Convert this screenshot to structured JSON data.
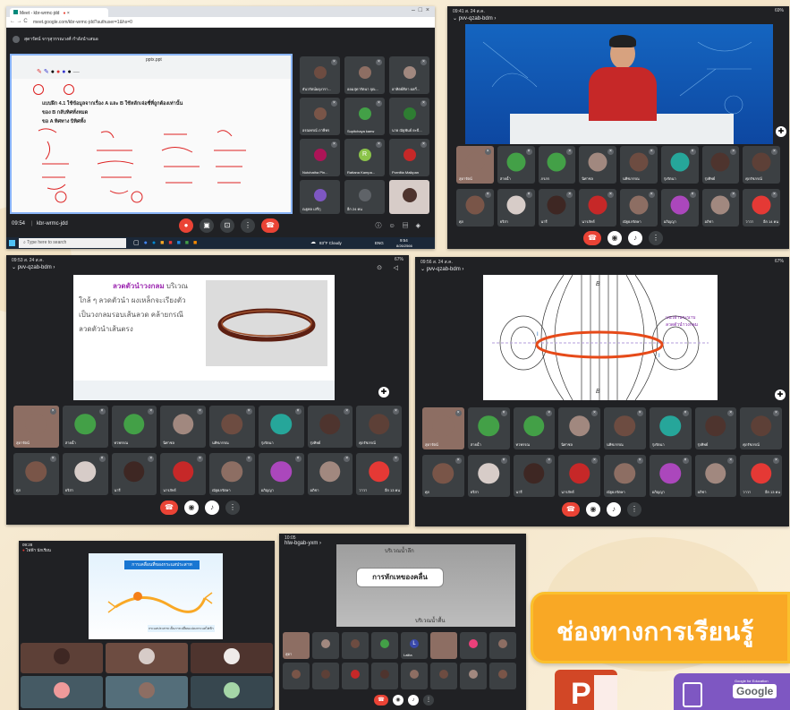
{
  "s1": {
    "tab_title": "Meet - kbr-wrmc-jdd",
    "url": "meet.google.com/kbr-wrmc-jdd?authuser=1&hs=0",
    "presenter": "สุดารัตน์ จารุสุวรรณวงศ์ กำลังนำเสนอ",
    "annotate_label": "pptx.ppt",
    "time": "09:54",
    "meeting_code": "kbr-wrmc-jdd",
    "taskbar_search": "Type here to search",
    "weather": "83°F Cloudy",
    "clock_time": "9:54",
    "clock_date": "8/26/2566",
    "lang": "ENG",
    "participants": [
      "ธันวรัตน์ผดุงวรา...",
      "ออมสุดารัตนา จุณ...",
      "อาทิตย์ศิลา ผลกี่...",
      "อรณทรณ์ ภาษีพร",
      "Supitchaya kaew",
      "นาย ณัฐพันธ์ ยะบี...",
      "Nutchatha Pin...",
      "Rattana Kampa...",
      "Pornfita Maikpan",
      "ณฐพล เสรีกุ",
      "อีก 24 คน",
      ""
    ],
    "lines": [
      "แบบฝึก 4.1 ใช้ข้อมูลจากเรื่อง A และ B ใช้หลักเจ่อซี่ที่ถูกต้องเท่านั้น",
      "ของ B กลับทิศทั่งหมด",
      "ขอ A ทิศทาง บิทิศทั้ง"
    ]
  },
  "s2": {
    "status_time": "09:41",
    "status_date": "ส. 24 ส.ค.",
    "battery": "69%",
    "meeting": "pvv-qzab-bdm",
    "names": [
      "สุดารัตน์",
      "สายน้ำ",
      "ภรภร",
      "นิศาชล",
      "นพิชภรรณ",
      "รุ่งรัตนา",
      "รุ่งทิพย์",
      "ศุภรัชภรณ์",
      "ศุภ",
      "ธริสา",
      "นารี",
      "นารภัทร์",
      "ณัฐธภรัตษา",
      "อภิญญา",
      "อภิชา",
      "วาวา"
    ],
    "more": "อีก 14 คน"
  },
  "s3": {
    "status_time": "09:53",
    "status_date": "ส. 24 ส.ค.",
    "battery": "67%",
    "meeting": "pvv-qzab-bdm",
    "heading": "ลวดตัวนำวงกลม",
    "text": [
      "บริเวณ",
      "ใกล้ ๆ ลวดตัวนำ ผงเหล็กจะเรียงตัว",
      "เป็นวงกลมรอบเส้นลวด คล้ายกรณี",
      "ลวดตัวนำเส้นตรง"
    ],
    "names": [
      "สุดารัตน์",
      "สายน้ำ",
      "ทวพรรณ",
      "นิศาชล",
      "นพิชภรรณ",
      "รุ่งรัตนา",
      "รุ่งทิพย์",
      "ศุภรัชภรณ์",
      "ศุภ",
      "ธริสา",
      "นารี",
      "นารภัทร์",
      "ณัฐธภรัตษา",
      "อภิญญา",
      "อภิชา",
      "วาวา"
    ],
    "more": "อีก 13 คน"
  },
  "s4": {
    "status_time": "09:56",
    "status_date": "ส. 24 ส.ค.",
    "battery": "67%",
    "meeting": "pvv-qzab-bdm",
    "label1": "แนวผ่านระนาบ",
    "label2": "ลวดตัวนำวงกลม",
    "b1": "B",
    "b2": "B",
    "i1": "I",
    "i2": "I",
    "names": [
      "สุดารัตน์",
      "สายน้ำ",
      "ทวพรรณ",
      "นิศาชล",
      "นพิชภรรณ",
      "รุ่งรัตนา",
      "รุ่งทิพย์",
      "ศุภรัชภรณ์",
      "ศุภ",
      "ธริสา",
      "นารี",
      "นารภัทร์",
      "ณัฐธภรัตษา",
      "อภิญญา",
      "อภิชา",
      "วาวา"
    ],
    "more": "อีก 13 คน"
  },
  "s5": {
    "status_time": "09:28",
    "top_label": "ไฟฟ้า นักเรียน",
    "slide_title": "การเคลื่อนที่ของกระแสประสาท",
    "caption": "กระแสประสาท เป็นการเปลี่ยนแปลงกระแสไฟฟ้า",
    "names": [
      "",
      "",
      "",
      "",
      "",
      ""
    ]
  },
  "s6": {
    "status_time": "10:05",
    "meeting": "hlw-bgab-yxm",
    "top_label": "บริเวณน้ำลึก",
    "bottom_label": "บริเวณน้ำตื้น",
    "bubble": "การหักเหของคลื่น",
    "names": [
      "สุดา",
      "",
      "",
      "",
      "Lalita",
      "",
      "",
      "",
      "",
      "",
      "",
      "",
      "",
      "",
      "",
      "",
      ""
    ],
    "letter": "L"
  },
  "banner": {
    "text": "ช่องทางการเรียนรู้",
    "gc_label": "Google for Education",
    "gc_name": "Google",
    "ppt_letter": "P"
  }
}
